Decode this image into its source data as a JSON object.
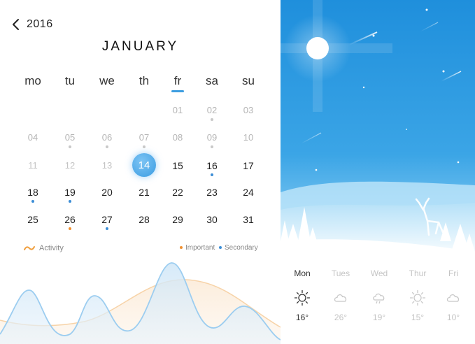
{
  "calendar": {
    "year": "2016",
    "month": "JANUARY",
    "weekdays": [
      "mo",
      "tu",
      "we",
      "th",
      "fr",
      "sa",
      "su"
    ],
    "selected_weekday": "fr",
    "today": "14",
    "days": [
      [
        "",
        "",
        "",
        "",
        "01",
        "02",
        "03"
      ],
      [
        "04",
        "05",
        "06",
        "07",
        "08",
        "09",
        "10"
      ],
      [
        "11",
        "12",
        "13",
        "14",
        "15",
        "16",
        "17"
      ],
      [
        "18",
        "19",
        "20",
        "21",
        "22",
        "23",
        "24"
      ],
      [
        "25",
        "26",
        "27",
        "28",
        "29",
        "30",
        "31"
      ]
    ],
    "colors": {
      "accent": "#3d9de0",
      "secondary": "#3d8ed6",
      "important": "#f09030",
      "past": "#c8c8c8"
    }
  },
  "legend": {
    "activity": "Activity",
    "important": "Important",
    "secondary": "Secondary"
  },
  "weather": {
    "forecast": [
      {
        "day": "Mon",
        "icon": "sun-icon",
        "temp": "16°"
      },
      {
        "day": "Tues",
        "icon": "cloud-icon",
        "temp": "26°"
      },
      {
        "day": "Wed",
        "icon": "rain-cloud-icon",
        "temp": "19°"
      },
      {
        "day": "Thur",
        "icon": "sun-icon",
        "temp": "15°"
      },
      {
        "day": "Fri",
        "icon": "cloud-icon",
        "temp": "10°"
      }
    ],
    "selected_day": "Mon"
  }
}
